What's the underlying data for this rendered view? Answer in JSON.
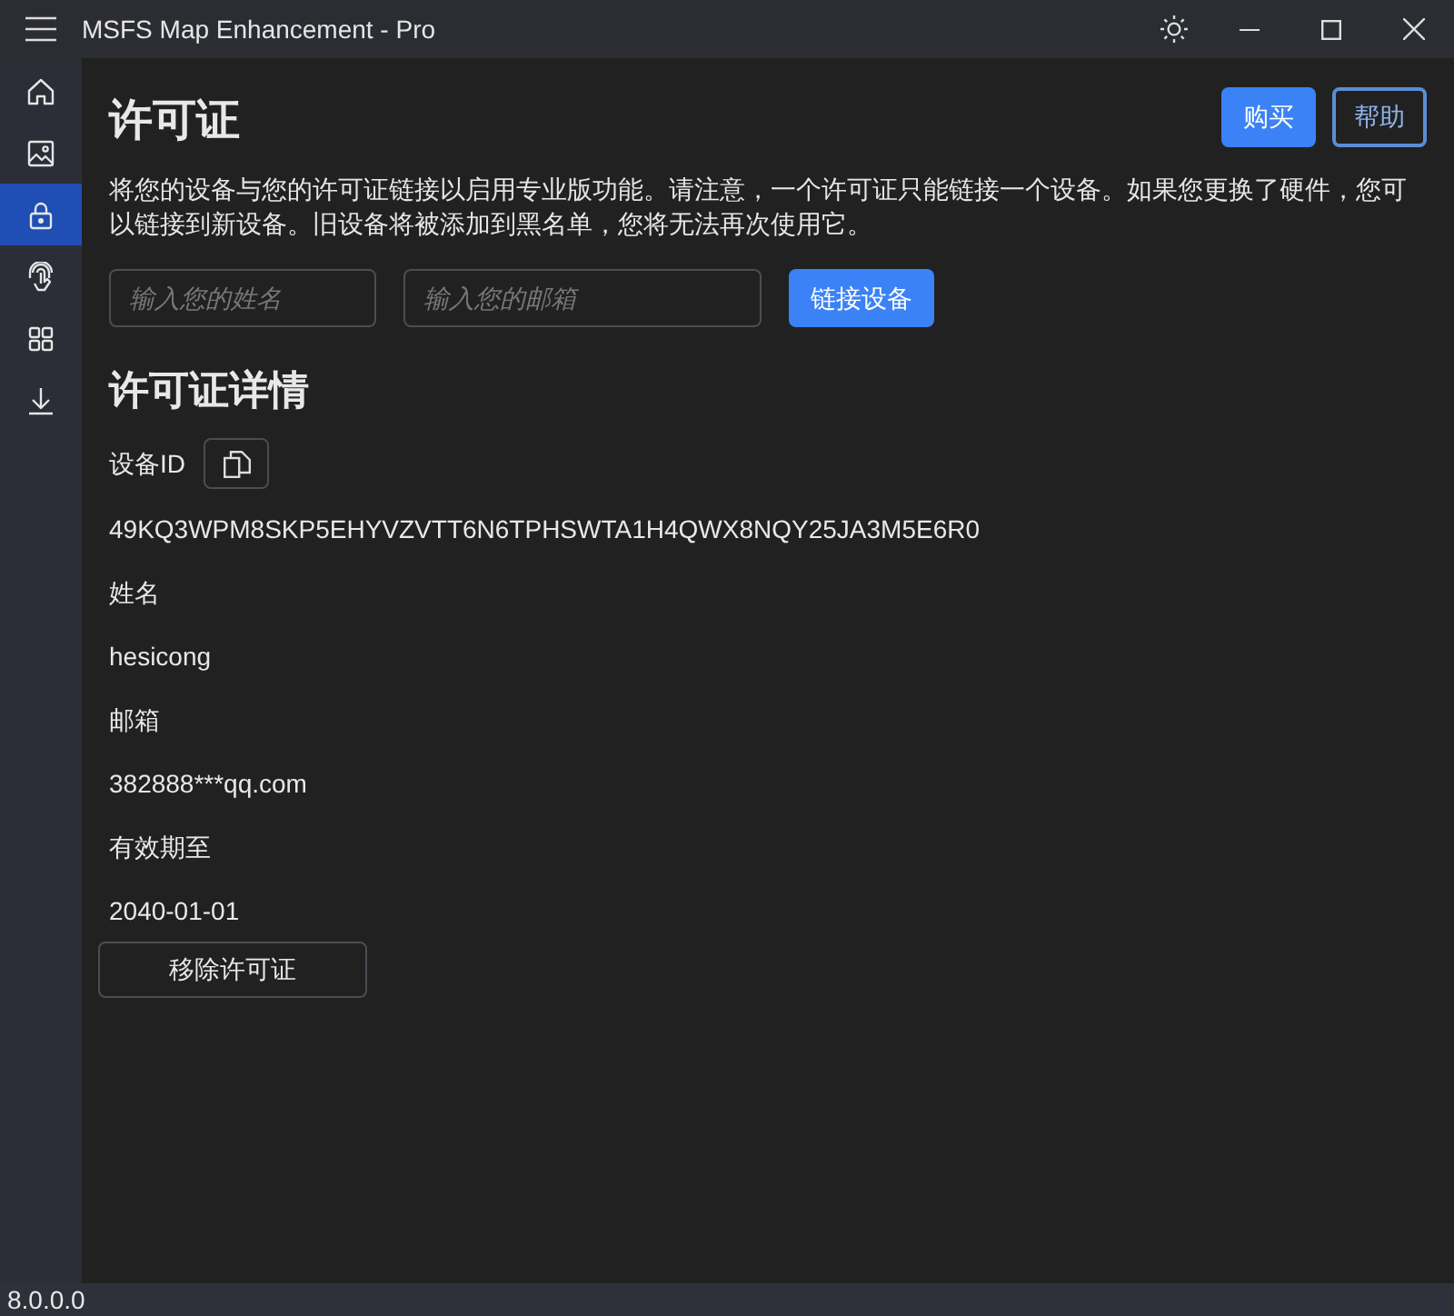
{
  "window": {
    "title": "MSFS Map Enhancement - Pro"
  },
  "sidebar": {
    "items": [
      {
        "kind": "home",
        "selected": false
      },
      {
        "kind": "image",
        "selected": false
      },
      {
        "kind": "lock",
        "selected": true
      },
      {
        "kind": "fingerprint",
        "selected": false
      },
      {
        "kind": "grid",
        "selected": false
      },
      {
        "kind": "download",
        "selected": false
      }
    ]
  },
  "license": {
    "title": "许可证",
    "buttons": [
      {
        "label": "购买",
        "kind": "primary"
      },
      {
        "label": "帮助",
        "kind": "outline"
      }
    ],
    "description": "将您的设备与您的许可证链接以启用专业版功能。请注意，一个许可证只能链接一个设备。如果您更换了硬件，您可以链接到新设备。旧设备将被添加到黑名单，您将无法再次使用它。",
    "name_field": {
      "placeholder": "输入您的姓名"
    },
    "email_field": {
      "placeholder": "输入您的邮箱"
    },
    "link_button": "链接设备"
  },
  "details": {
    "title": "许可证详情",
    "device_id_label": "设备ID",
    "device_id": "49KQ3WPM8SKP5EHYVZVTT6N6TPHSWTA1H4QWX8NQY25JA3M5E6R0",
    "fields": [
      {
        "label": "姓名",
        "value": "hesicong"
      },
      {
        "label": "邮箱",
        "value": "382888***qq.com"
      },
      {
        "label": "有效期至",
        "value": "2040-01-01"
      }
    ],
    "remove_button": "移除许可证"
  },
  "status_bar": {
    "version": "8.0.0.0"
  }
}
